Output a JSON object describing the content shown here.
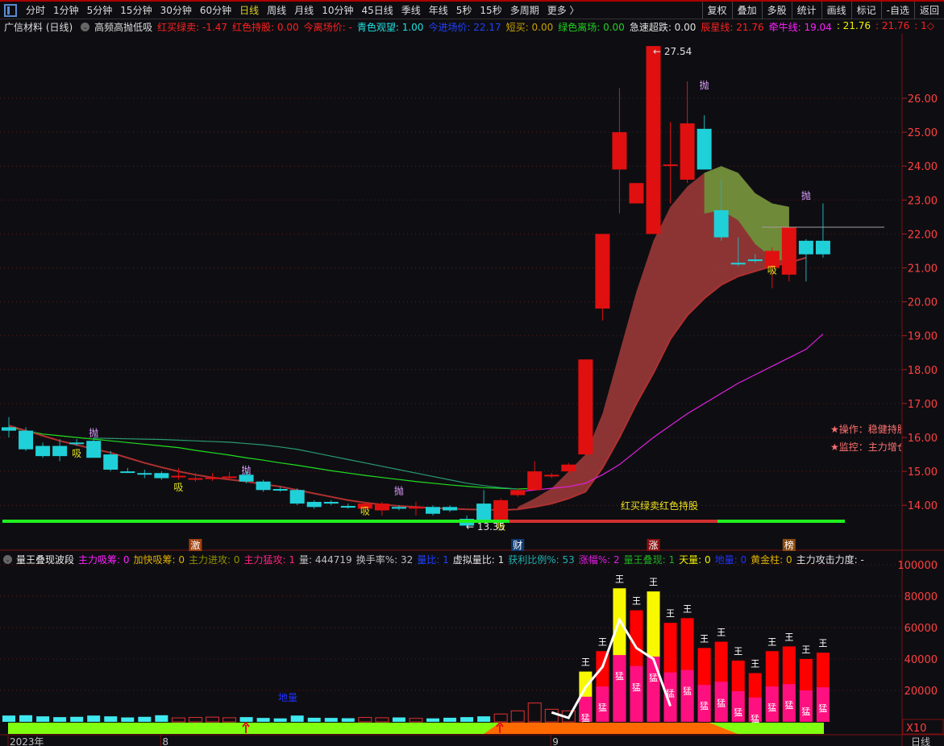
{
  "toolbar": {
    "periods": [
      "分时",
      "1分钟",
      "5分钟",
      "15分钟",
      "30分钟",
      "60分钟",
      "日线",
      "周线",
      "月线",
      "10分钟",
      "45日线",
      "季线",
      "年线",
      "5秒",
      "15秒",
      "多周期",
      "更多 〉"
    ],
    "active": "日线",
    "right": [
      "复权",
      "叠加",
      "多股",
      "统计",
      "画线",
      "标记",
      "-自选",
      "返回"
    ]
  },
  "info": {
    "title": "广信材料 (日线)",
    "indicator": "高频高抛低吸",
    "items": [
      {
        "t": "红买绿卖: -1.47",
        "c": "#ff2020"
      },
      {
        "t": "红色持股: 0.00",
        "c": "#ff2020"
      },
      {
        "t": "今离场价: -",
        "c": "#ff2020"
      },
      {
        "t": "青色观望: 1.00",
        "c": "#20e0e0"
      },
      {
        "t": "今进场价: 22.17",
        "c": "#2040ff"
      },
      {
        "t": "短买: 0.00",
        "c": "#c8a000"
      },
      {
        "t": "绿色离场: 0.00",
        "c": "#20d020"
      },
      {
        "t": "急速超跌: 0.00",
        "c": "#e0e0e0"
      },
      {
        "t": "辰星线: 21.76",
        "c": "#ff2020"
      },
      {
        "t": "牵牛线: 19.04",
        "c": "#ff20ff"
      },
      {
        "t": ": 21.76",
        "c": "#f0f000"
      },
      {
        "t": ": 21.76",
        "c": "#ff2020"
      },
      {
        "t": ": 1◇",
        "c": "#ff2020"
      }
    ]
  },
  "info2": {
    "indicator": "量王叠现波段",
    "items": [
      {
        "t": "主力吸筹: 0",
        "c": "#ff20ff"
      },
      {
        "t": "加快吸筹: 0",
        "c": "#e0b000"
      },
      {
        "t": "主力进攻: 0",
        "c": "#909000"
      },
      {
        "t": "主力猛攻: 1",
        "c": "#ff2080"
      },
      {
        "t": "量: 444719",
        "c": "#c0c0c0"
      },
      {
        "t": "换手率%: 32",
        "c": "#c0c0c0"
      },
      {
        "t": "量比: 1",
        "c": "#2040ff"
      },
      {
        "t": "虚拟量比: 1",
        "c": "#e0e0e0"
      },
      {
        "t": "获利比例%: 53",
        "c": "#20b0b0"
      },
      {
        "t": "涨幅%: 2",
        "c": "#e020e0"
      },
      {
        "t": "量王叠现: 1",
        "c": "#20b020"
      },
      {
        "t": "天量: 0",
        "c": "#f0f000"
      },
      {
        "t": "地量: 0",
        "c": "#2030ff"
      },
      {
        "t": "黄金柱: 0",
        "c": "#e0b000"
      },
      {
        "t": "主力攻击力度: -",
        "c": "#e0e0e0"
      }
    ]
  },
  "side": {
    "op": "★操作：稳健持股",
    "mon": "★监控：主力增仓"
  },
  "annotations": {
    "high": "← 27.54",
    "low": "← 13.35",
    "band": "红买绿卖红色持股",
    "dilang": "地量",
    "x10": "X10",
    "period": "日线"
  },
  "markers": [
    {
      "t": "激",
      "i": 11,
      "bg": "#a04010"
    },
    {
      "t": "财",
      "i": 30,
      "bg": "#103a70"
    },
    {
      "t": "涨",
      "i": 38,
      "bg": "#8a1010"
    },
    {
      "t": "榜",
      "i": 46,
      "bg": "#8a4a10"
    }
  ],
  "dates": [
    {
      "t": "2023年",
      "i": 0
    },
    {
      "t": "8",
      "i": 9
    },
    {
      "t": "9",
      "i": 32
    }
  ],
  "chart_data": [
    {
      "type": "candlestick",
      "yaxis": {
        "ticks": [
          14,
          15,
          16,
          17,
          18,
          19,
          20,
          21,
          22,
          23,
          24,
          25,
          26
        ]
      },
      "open": [
        16.3,
        16.2,
        15.75,
        15.75,
        15.85,
        15.9,
        15.5,
        15.0,
        14.95,
        14.95,
        14.85,
        14.78,
        14.8,
        14.83,
        14.9,
        14.7,
        14.48,
        14.45,
        14.1,
        14.1,
        13.98,
        13.9,
        13.85,
        13.95,
        13.93,
        13.95,
        13.95,
        13.6,
        14.05,
        13.5,
        14.3,
        14.45,
        14.85,
        15.0,
        15.5,
        19.8,
        23.9,
        22.9,
        22.0,
        24.05,
        23.6,
        25.1,
        22.7,
        21.15,
        21.25,
        21.0,
        20.8,
        21.8,
        21.8
      ],
      "high": [
        16.6,
        16.3,
        15.85,
        15.95,
        15.95,
        16.0,
        15.6,
        15.1,
        15.05,
        15.0,
        15.1,
        14.95,
        14.95,
        14.98,
        15.0,
        14.75,
        14.55,
        14.5,
        14.15,
        14.15,
        14.05,
        14.1,
        14.1,
        14.0,
        14.1,
        14.0,
        14.0,
        13.7,
        14.45,
        14.2,
        14.5,
        15.3,
        14.95,
        15.25,
        18.3,
        22.0,
        26.3,
        23.5,
        27.54,
        25.3,
        26.5,
        25.5,
        23.6,
        21.9,
        21.4,
        21.6,
        22.2,
        21.85,
        22.9
      ],
      "low": [
        16.0,
        15.6,
        15.4,
        15.3,
        15.75,
        15.4,
        15.0,
        14.95,
        14.8,
        14.75,
        14.75,
        14.7,
        14.72,
        14.75,
        14.65,
        14.4,
        14.4,
        14.0,
        13.9,
        14.0,
        13.9,
        13.85,
        13.7,
        13.85,
        13.7,
        13.7,
        13.8,
        13.35,
        13.5,
        13.45,
        14.25,
        14.45,
        14.8,
        14.95,
        15.45,
        19.45,
        22.6,
        22.9,
        22.0,
        22.9,
        23.5,
        23.9,
        21.8,
        21.05,
        21.15,
        20.4,
        20.6,
        20.6,
        21.3
      ],
      "close": [
        16.2,
        15.65,
        15.45,
        15.45,
        15.83,
        15.4,
        15.05,
        14.98,
        14.92,
        14.8,
        14.87,
        14.8,
        14.82,
        14.85,
        14.7,
        14.45,
        14.45,
        14.05,
        13.95,
        14.05,
        13.93,
        14.05,
        14.05,
        13.9,
        13.95,
        13.75,
        13.85,
        13.4,
        13.55,
        14.15,
        14.45,
        15.0,
        14.9,
        15.2,
        18.3,
        22.0,
        25.0,
        23.5,
        27.54,
        24.05,
        25.26,
        23.9,
        21.9,
        21.1,
        21.2,
        21.5,
        22.2,
        21.4,
        21.4
      ],
      "lines": [
        {
          "color": "#20e020",
          "values": [
            16.3,
            16.2,
            16.1,
            16.05,
            16.0,
            15.95,
            15.9,
            15.85,
            15.8,
            15.75,
            15.7,
            15.62,
            15.55,
            15.48,
            15.4,
            15.33,
            15.25,
            15.18,
            15.1,
            15.02,
            14.95,
            14.88,
            14.82,
            14.76,
            14.7,
            14.65,
            14.6,
            14.56,
            14.52,
            14.5,
            14.48,
            14.5
          ]
        },
        {
          "color": "#2a9a70",
          "values": [
            null,
            null,
            null,
            null,
            null,
            15.98,
            15.97,
            15.96,
            15.95,
            15.94,
            15.92,
            15.9,
            15.88,
            15.86,
            15.82,
            15.78,
            15.72,
            15.65,
            15.55,
            15.45,
            15.35,
            15.25,
            15.15,
            15.05,
            14.95,
            14.85,
            14.75,
            14.65,
            14.58,
            14.52,
            14.48
          ]
        },
        {
          "color": "#b03030",
          "values": [
            16.35,
            16.2,
            16.05,
            15.9,
            15.78,
            15.66,
            15.55,
            15.4,
            15.25,
            15.12,
            15.0,
            14.9,
            14.82,
            14.76,
            14.7,
            14.62,
            14.55,
            14.45,
            14.35,
            14.25,
            14.15,
            14.08,
            14.02,
            13.98,
            13.95,
            13.92,
            13.9,
            13.88,
            13.87,
            13.86,
            13.88,
            13.95,
            14.05,
            14.2,
            14.4,
            15.1,
            16.0,
            17.0,
            17.9,
            18.9,
            19.6,
            20.1,
            20.5,
            20.75,
            20.9,
            21.05,
            21.15,
            21.3,
            null
          ]
        },
        {
          "color": "#e020e0",
          "values": [
            null,
            null,
            null,
            null,
            null,
            null,
            null,
            null,
            null,
            null,
            null,
            null,
            null,
            null,
            null,
            null,
            null,
            null,
            null,
            null,
            null,
            null,
            null,
            null,
            null,
            null,
            null,
            null,
            null,
            null,
            14.4,
            14.45,
            14.5,
            14.55,
            14.65,
            14.9,
            15.2,
            15.6,
            16.0,
            16.35,
            16.7,
            17.0,
            17.3,
            17.6,
            17.85,
            18.1,
            18.35,
            18.6,
            19.05
          ]
        }
      ],
      "band_upper": [
        13.95,
        14.2,
        14.5,
        15.0,
        15.5,
        16.7,
        18.5,
        20.3,
        21.8,
        22.8,
        23.4,
        23.8,
        24.0,
        23.8,
        23.2,
        22.9,
        22.8
      ],
      "band_start": 30,
      "signals": [
        {
          "t": "抛",
          "i": 5,
          "p": 16.15
        },
        {
          "t": "抛",
          "i": 14,
          "p": 15.05
        },
        {
          "t": "抛",
          "i": 23,
          "p": 14.45
        },
        {
          "t": "抛",
          "i": 41,
          "p": 26.4
        },
        {
          "t": "抛",
          "i": 47,
          "p": 23.15
        },
        {
          "t": "吸",
          "i": 4,
          "p": 15.55
        },
        {
          "t": "吸",
          "i": 10,
          "p": 14.55
        },
        {
          "t": "吸",
          "i": 21,
          "p": 13.85
        },
        {
          "t": "吸",
          "i": 29,
          "p": 13.4
        },
        {
          "t": "吸",
          "i": 45,
          "p": 20.95
        }
      ],
      "ref_line": 22.2
    },
    {
      "type": "bar",
      "yaxis": {
        "ticks": [
          20000,
          40000,
          60000,
          80000,
          100000
        ],
        "multiplier": "X10"
      },
      "values": [
        4000,
        4200,
        3500,
        3000,
        3200,
        4000,
        3500,
        2800,
        3200,
        4200,
        2500,
        2800,
        3000,
        2600,
        3000,
        2500,
        2200,
        4000,
        2600,
        2500,
        2300,
        2800,
        2600,
        2800,
        2200,
        2200,
        2600,
        3000,
        3500,
        5000,
        7000,
        12000,
        8000,
        7000,
        32000,
        45000,
        85000,
        71000,
        83000,
        63000,
        66000,
        47000,
        51000,
        39000,
        31000,
        45000,
        48000,
        40000,
        44000
      ],
      "ma": [
        null,
        null,
        null,
        null,
        null,
        null,
        null,
        null,
        null,
        null,
        null,
        null,
        null,
        null,
        null,
        null,
        null,
        null,
        null,
        null,
        null,
        null,
        null,
        null,
        null,
        null,
        null,
        null,
        null,
        null,
        null,
        null,
        6000,
        2500,
        22000,
        35000,
        65000,
        47000,
        40000,
        10000
      ]
    }
  ]
}
